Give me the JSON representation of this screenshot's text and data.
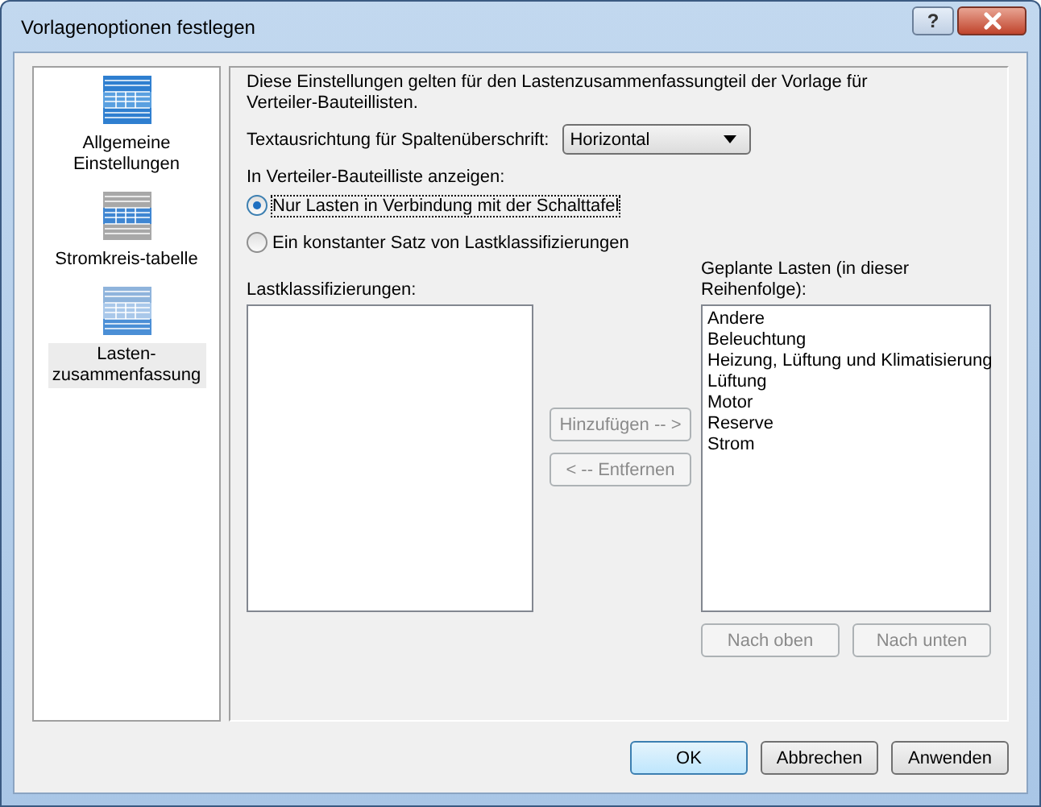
{
  "window": {
    "title": "Vorlagenoptionen festlegen",
    "help_button": "?"
  },
  "sidebar": {
    "items": [
      {
        "label": "Allgemeine Einstellungen",
        "selected": false
      },
      {
        "label": "Stromkreis-tabelle",
        "selected": false
      },
      {
        "label": "Lasten-zusammenfassung",
        "selected": true
      }
    ]
  },
  "panel": {
    "description": "Diese Einstellungen gelten für den Lastenzusammenfassungteil der Vorlage für Verteiler-Bauteillisten.",
    "orientation": {
      "label": "Textausrichtung für Spaltenüberschrift:",
      "value": "Horizontal"
    },
    "display_label": "In Verteiler-Bauteilliste anzeigen:",
    "radios": [
      {
        "label": "Nur Lasten in Verbindung mit der Schalttafel",
        "selected": true
      },
      {
        "label": "Ein konstanter Satz von Lastklassifizierungen",
        "selected": false
      }
    ],
    "classifications": {
      "label": "Lastklassifizierungen:"
    },
    "transfer_buttons": [
      {
        "label": "Hinzufügen -- >",
        "disabled": true
      },
      {
        "label": "< -- Entfernen",
        "disabled": true
      }
    ],
    "planned": {
      "label": "Geplante Lasten (in dieser Reihenfolge):",
      "items": [
        "Andere",
        "Beleuchtung",
        "Heizung, Lüftung und Klimatisierung",
        "Lüftung",
        "Motor",
        "Reserve",
        "Strom"
      ]
    },
    "order_buttons": [
      {
        "label": "Nach oben",
        "disabled": true
      },
      {
        "label": "Nach unten",
        "disabled": true
      }
    ]
  },
  "buttons": [
    {
      "label": "OK",
      "default": true
    },
    {
      "label": "Abbrechen",
      "default": false
    },
    {
      "label": "Anwenden",
      "default": false
    }
  ]
}
